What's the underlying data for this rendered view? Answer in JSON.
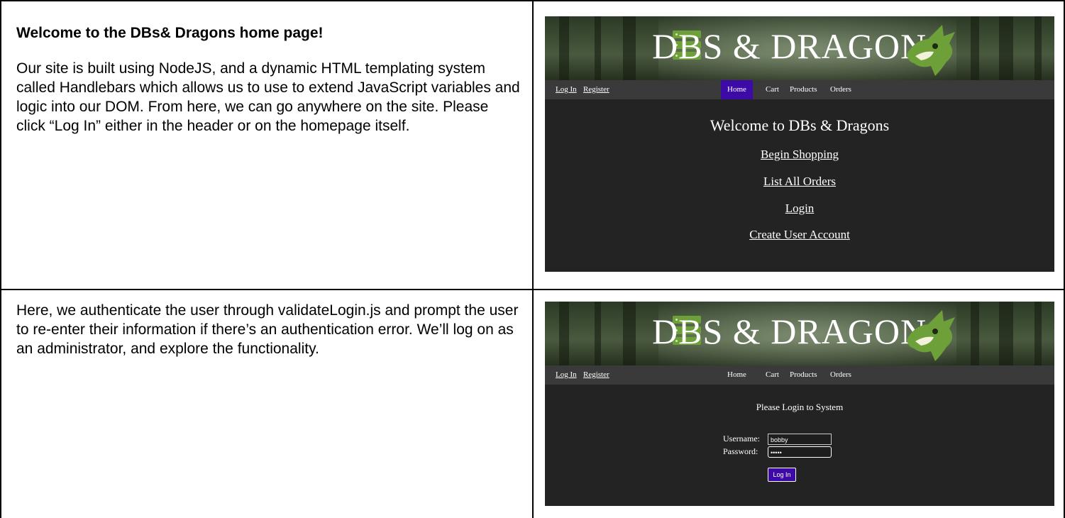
{
  "row1": {
    "heading": "Welcome to the DBs& Dragons home page!",
    "text": "Our site is built using NodeJS, and a dynamic HTML templating system called Handlebars which allows us to use to extend JavaScript variables and logic into our DOM. From here, we can go anywhere on the site. Please click “Log In” either in the header or on the homepage itself."
  },
  "row2": {
    "text": "Here, we authenticate the user through validateLogin.js and prompt the user to re-enter their information if there’s an authentication error. We’ll log on as an administrator, and explore the functionality."
  },
  "site": {
    "brand": "DBS & DRAGONS",
    "nav": {
      "login": "Log In",
      "register": "Register",
      "home": "Home",
      "cart": "Cart",
      "products": "Products",
      "orders": "Orders"
    }
  },
  "home_page": {
    "title": "Welcome to DBs & Dragons",
    "links": [
      "Begin Shopping",
      "List All Orders",
      "Login",
      "Create User Account"
    ]
  },
  "login_page": {
    "title": "Please Login to System",
    "username_label": "Username:",
    "username_value": "bobby",
    "password_label": "Password:",
    "password_value": "•••••",
    "submit_label": "Log In"
  },
  "colors": {
    "active_nav": "#3d0aa8",
    "page_bg": "#232323",
    "nav_bg": "#3a3a3a",
    "logo_green": "#6ea039"
  }
}
